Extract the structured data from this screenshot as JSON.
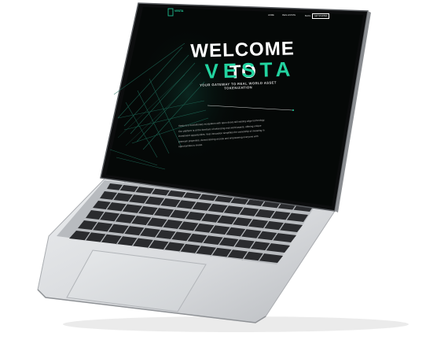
{
  "site": {
    "logo_text": "VESTA",
    "nav": [
      "HOME",
      "REAL ESTATE",
      "BLOG"
    ],
    "cta_label": "GET STARTED"
  },
  "hero": {
    "title": "WELCOME TO",
    "brand": "VESTA",
    "tagline": "YOUR GATEWAY TO REAL WORLD ASSET TOKENIZATION",
    "body": "Vesta is a revolutionary ecosystem with open doors still waiting edge technology. Our platform is at the forefront of tokenizing real world assets, offering unique investment opportunities. Vest innovation simplifies the ownership of investing in premium properties, democratizing access and empowering everyone with opportunities to invest."
  },
  "colors": {
    "accent": "#22d3a0",
    "screen_bg": "#050807",
    "laptop_body": "#d9dadc",
    "keys": "#2a2b2e"
  }
}
